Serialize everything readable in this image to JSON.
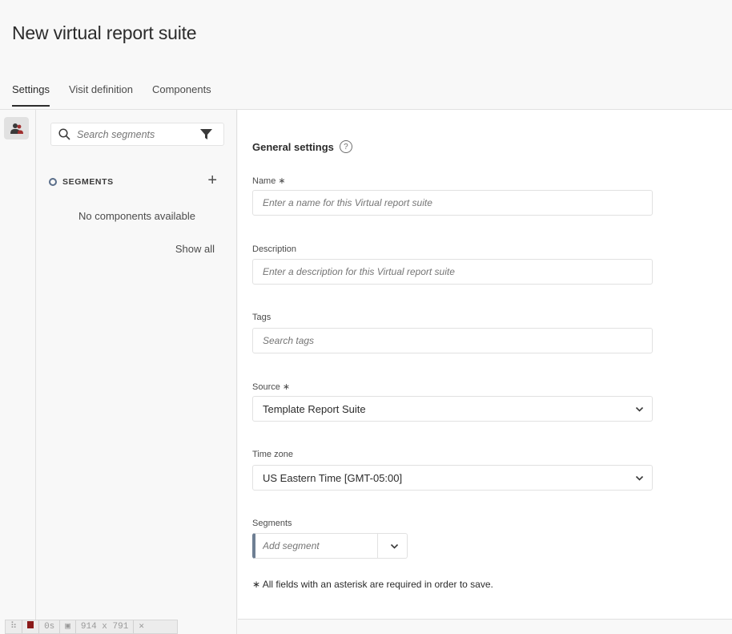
{
  "page_title": "New virtual report suite",
  "tabs": [
    {
      "label": "Settings",
      "active": true
    },
    {
      "label": "Visit definition",
      "active": false
    },
    {
      "label": "Components",
      "active": false
    }
  ],
  "rail": {
    "icon": "user-segments-icon"
  },
  "left_panel": {
    "search_placeholder": "Search segments",
    "section_title": "SEGMENTS",
    "add_label": "+",
    "empty_message": "No components available",
    "show_all": "Show all"
  },
  "general": {
    "title": "General settings",
    "help": "?",
    "name": {
      "label": "Name ∗",
      "placeholder": "Enter a name for this Virtual report suite"
    },
    "description": {
      "label": "Description",
      "placeholder": "Enter a description for this Virtual report suite"
    },
    "tags": {
      "label": "Tags",
      "placeholder": "Search tags"
    },
    "source": {
      "label": "Source ∗",
      "value": "Template Report Suite"
    },
    "timezone": {
      "label": "Time zone",
      "value": "US Eastern Time [GMT-05:00]"
    },
    "segments": {
      "label": "Segments",
      "placeholder": "Add segment"
    },
    "required_note": "∗ All fields with an asterisk are required in order to save."
  },
  "devbar": {
    "grip": "⠷",
    "time": "0s",
    "size": "914 x 791",
    "close": "✕"
  }
}
